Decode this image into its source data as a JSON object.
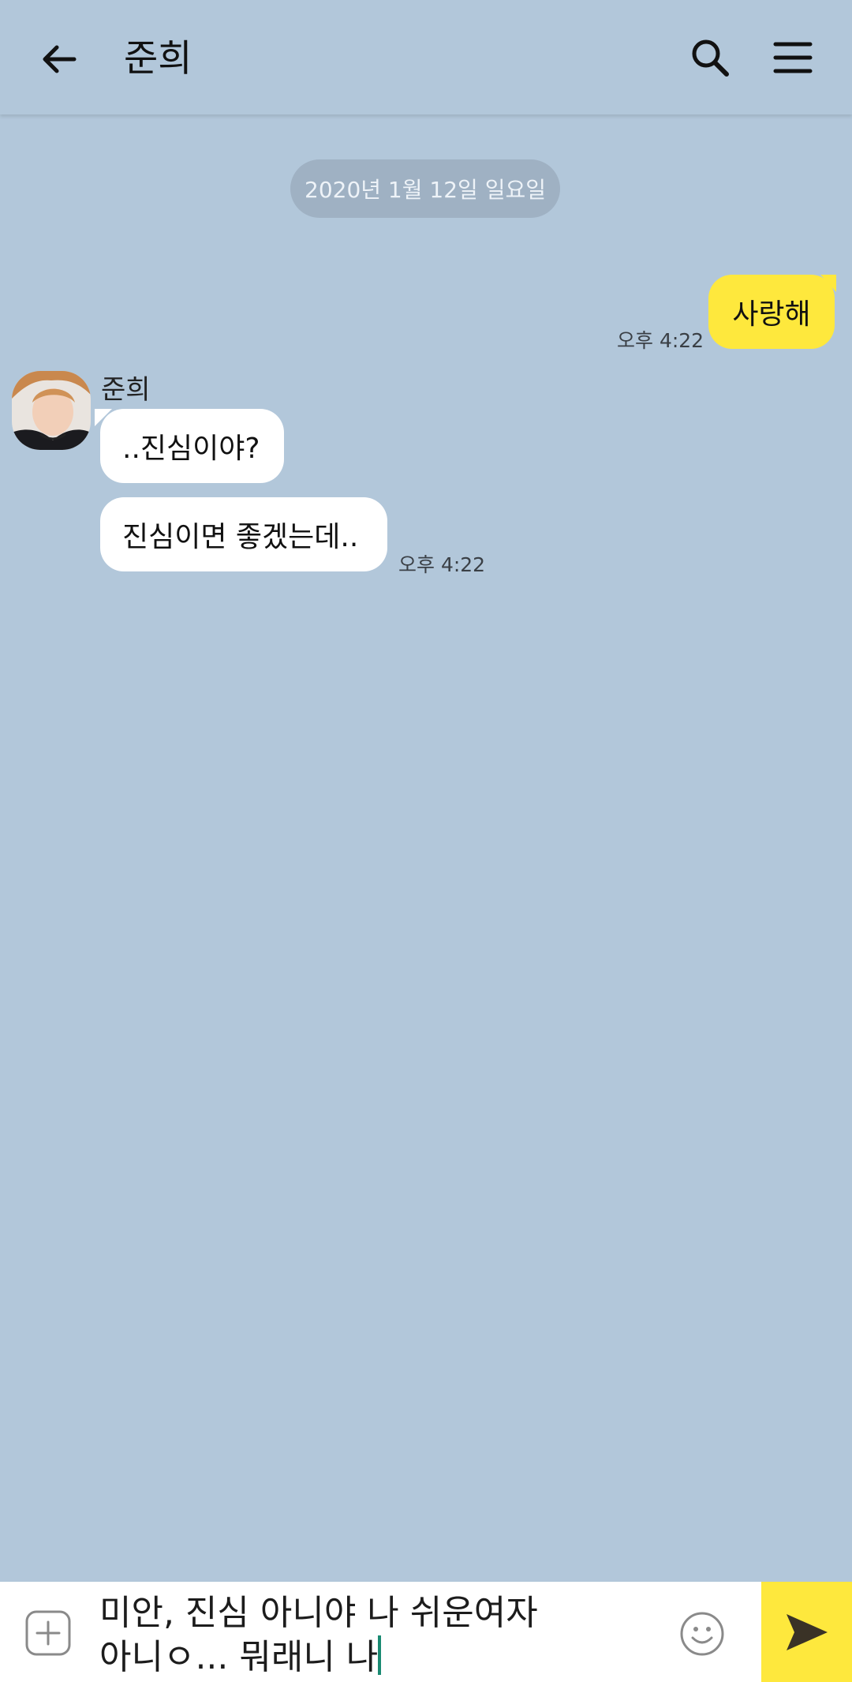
{
  "header": {
    "title": "준희",
    "back_icon": "arrow-left-icon",
    "search_icon": "search-icon",
    "menu_icon": "hamburger-menu-icon"
  },
  "date_divider": "2020년 1월 12일 일요일",
  "messages": [
    {
      "direction": "outgoing",
      "text": "사랑해",
      "time": "오후 4:22"
    },
    {
      "direction": "incoming",
      "sender": "준희",
      "text": "..진심이야?"
    },
    {
      "direction": "incoming",
      "text": "진심이면 좋겠는데..",
      "time": "오후 4:22"
    }
  ],
  "input": {
    "value": "미안, 진심 아니야 나 쉬운여자\n아니ㅇ... 뭐래니 나",
    "plus_icon": "plus-icon",
    "emoji_icon": "emoji-icon",
    "send_icon": "send-icon"
  },
  "colors": {
    "background": "#b2c7da",
    "outgoing_bubble": "#fee83d",
    "incoming_bubble": "#ffffff",
    "send_button": "#fee83d"
  }
}
